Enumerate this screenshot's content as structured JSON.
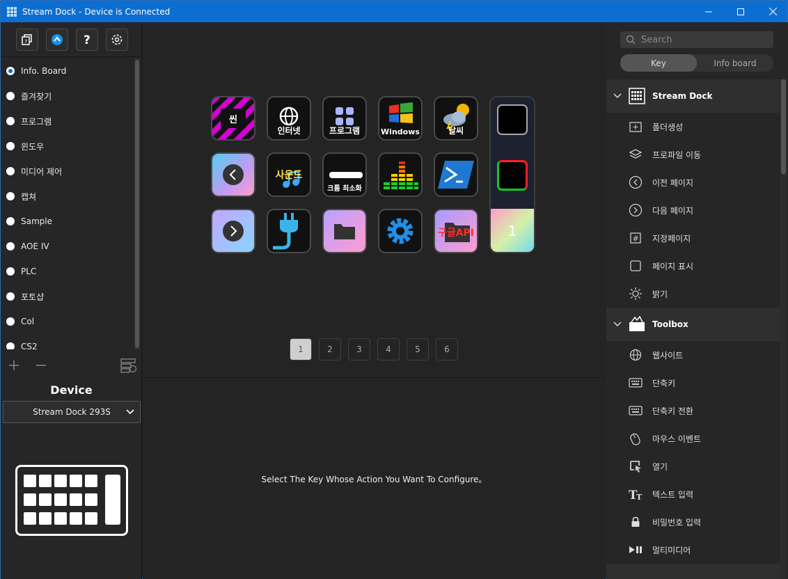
{
  "window": {
    "title": "Stream Dock - Device is Connected"
  },
  "profiles": [
    {
      "label": "Info. Board",
      "selected": true
    },
    {
      "label": "즐겨찾기",
      "selected": false
    },
    {
      "label": "프로그램",
      "selected": false
    },
    {
      "label": "윈도우",
      "selected": false
    },
    {
      "label": "미디어 제어",
      "selected": false
    },
    {
      "label": "캡쳐",
      "selected": false
    },
    {
      "label": "Sample",
      "selected": false
    },
    {
      "label": "AOE IV",
      "selected": false
    },
    {
      "label": "PLC",
      "selected": false
    },
    {
      "label": "포토샵",
      "selected": false
    },
    {
      "label": "Col",
      "selected": false
    },
    {
      "label": "CS2",
      "selected": false
    }
  ],
  "device": {
    "title": "Device",
    "selected": "Stream Dock 293S"
  },
  "keys": {
    "k1": "씬",
    "k2": "인터넷",
    "k3": "프로그램",
    "k4": "Windows",
    "k5": "날씨",
    "k8": "사운드",
    "k9": "크롬 최소화",
    "k15": "구글API",
    "k16": "1"
  },
  "pages": [
    "1",
    "2",
    "3",
    "4",
    "5",
    "6"
  ],
  "hint": "Select The Key Whose Action You Want To Configure。",
  "search": {
    "placeholder": "Search"
  },
  "tabs": [
    "Key",
    "Info board"
  ],
  "categories": [
    {
      "name": "Stream Dock",
      "actions": [
        "폴더생성",
        "프로파일 이동",
        "이전 페이지",
        "다음 페이지",
        "지정페이지",
        "페이지 표시",
        "밝기"
      ]
    },
    {
      "name": "Toolbox",
      "actions": [
        "웹사이트",
        "단축키",
        "단축키 전환",
        "마우스 이벤트",
        "열기",
        "텍스트 입력",
        "비밀번호 입력",
        "멀티미디어"
      ]
    }
  ],
  "colors": {
    "titlebar": "#0d6ed1",
    "accent": "#0d6ed1"
  }
}
